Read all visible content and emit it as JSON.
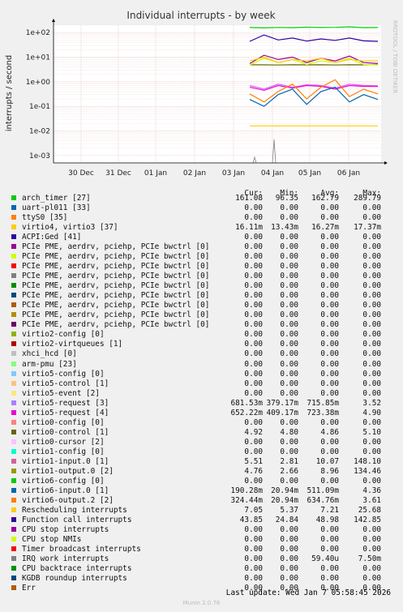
{
  "chart_data": {
    "type": "line",
    "title": "Individual interrupts - by week",
    "ylabel": "interrupts / second",
    "yscale": "log",
    "ylim": [
      0.0005,
      200
    ],
    "y_ticks": [
      "1e+02",
      "1e+01",
      "1e+00",
      "1e-01",
      "1e-02",
      "1e-03"
    ],
    "x_ticks": [
      "30 Dec",
      "31 Dec",
      "01 Jan",
      "02 Jan",
      "03 Jan",
      "04 Jan",
      "05 Jan",
      "06 Jan"
    ],
    "data_start_label": "04 Jan",
    "series": [
      {
        "name": "arch_timer [27]",
        "color": "#00cc00",
        "values": [
          160,
          155,
          162,
          158,
          165,
          160,
          163,
          170,
          158,
          161
        ]
      },
      {
        "name": "uart-pl011 [33]",
        "color": "#0066b3",
        "values": []
      },
      {
        "name": "ttyS0 [35]",
        "color": "#ff8000",
        "values": []
      },
      {
        "name": "virtio4, virtio3 [37]",
        "color": "#ffcc00",
        "values": [
          0.016,
          0.016,
          0.016,
          0.016,
          0.016,
          0.016,
          0.016,
          0.016,
          0.016,
          0.016
        ]
      },
      {
        "name": "virtio5-request [3]",
        "color": "#cc66ff",
        "values": [
          0.7,
          0.5,
          0.8,
          0.6,
          0.75,
          0.7,
          0.55,
          0.8,
          0.7,
          0.68
        ]
      },
      {
        "name": "virtio5-request [4]",
        "color": "#ff00cc",
        "values": [
          0.6,
          0.45,
          0.7,
          0.55,
          0.7,
          0.65,
          0.5,
          0.7,
          0.65,
          0.65
        ]
      },
      {
        "name": "virtio0-control [1]",
        "color": "#666600",
        "values": [
          4.9,
          4.85,
          4.8,
          4.9,
          4.85,
          4.9,
          4.8,
          4.9,
          4.85,
          4.92
        ]
      },
      {
        "name": "virtio1-input.0 [1]",
        "color": "#990099",
        "values": [
          5.5,
          12,
          8,
          10,
          6,
          9,
          7,
          11,
          6,
          5.5
        ]
      },
      {
        "name": "virtio1-output.0 [2]",
        "color": "#ccff00",
        "values": [
          4.8,
          9,
          6,
          8,
          5,
          7,
          6,
          9,
          5,
          4.8
        ]
      },
      {
        "name": "virtio6-input.0 [1]",
        "color": "#0066b3",
        "values": [
          0.19,
          0.1,
          0.3,
          0.5,
          0.12,
          0.4,
          0.6,
          0.15,
          0.3,
          0.19
        ]
      },
      {
        "name": "virtio6-output.2 [2]",
        "color": "#ff8000",
        "values": [
          0.32,
          0.15,
          0.4,
          0.8,
          0.2,
          0.6,
          1.2,
          0.25,
          0.5,
          0.32
        ]
      },
      {
        "name": "Rescheduling interrupts",
        "color": "#ffcc00",
        "values": [
          7,
          10,
          6,
          8,
          7,
          9,
          6,
          8,
          7,
          7.05
        ]
      },
      {
        "name": "Function call interrupts",
        "color": "#330099",
        "values": [
          44,
          80,
          50,
          60,
          45,
          55,
          48,
          60,
          46,
          43.85
        ]
      }
    ]
  },
  "legend": {
    "headers": {
      "cur": "Cur:",
      "min": "Min:",
      "avg": "Avg:",
      "max": "Max:"
    },
    "rows": [
      {
        "color": "#00cc00",
        "name": "arch_timer [27]",
        "cur": "161.08",
        "min": "96.35",
        "avg": "162.79",
        "max": "289.79"
      },
      {
        "color": "#0066b3",
        "name": "uart-pl011 [33]",
        "cur": "0.00",
        "min": "0.00",
        "avg": "0.00",
        "max": "0.00"
      },
      {
        "color": "#ff8000",
        "name": "ttyS0 [35]",
        "cur": "0.00",
        "min": "0.00",
        "avg": "0.00",
        "max": "0.00"
      },
      {
        "color": "#ffcc00",
        "name": "virtio4, virtio3 [37]",
        "cur": "16.11m",
        "min": "13.43m",
        "avg": "16.27m",
        "max": "17.37m"
      },
      {
        "color": "#330099",
        "name": "ACPI:Ged [41]",
        "cur": "0.00",
        "min": "0.00",
        "avg": "0.00",
        "max": "0.00"
      },
      {
        "color": "#990099",
        "name": "PCIe PME, aerdrv, pciehp, PCIe bwctrl [0]",
        "cur": "0.00",
        "min": "0.00",
        "avg": "0.00",
        "max": "0.00"
      },
      {
        "color": "#ccff00",
        "name": "PCIe PME, aerdrv, pciehp, PCIe bwctrl [0]",
        "cur": "0.00",
        "min": "0.00",
        "avg": "0.00",
        "max": "0.00"
      },
      {
        "color": "#ff0000",
        "name": "PCIe PME, aerdrv, pciehp, PCIe bwctrl [0]",
        "cur": "0.00",
        "min": "0.00",
        "avg": "0.00",
        "max": "0.00"
      },
      {
        "color": "#808080",
        "name": "PCIe PME, aerdrv, pciehp, PCIe bwctrl [0]",
        "cur": "0.00",
        "min": "0.00",
        "avg": "0.00",
        "max": "0.00"
      },
      {
        "color": "#008f00",
        "name": "PCIe PME, aerdrv, pciehp, PCIe bwctrl [0]",
        "cur": "0.00",
        "min": "0.00",
        "avg": "0.00",
        "max": "0.00"
      },
      {
        "color": "#00487d",
        "name": "PCIe PME, aerdrv, pciehp, PCIe bwctrl [0]",
        "cur": "0.00",
        "min": "0.00",
        "avg": "0.00",
        "max": "0.00"
      },
      {
        "color": "#b35a00",
        "name": "PCIe PME, aerdrv, pciehp, PCIe bwctrl [0]",
        "cur": "0.00",
        "min": "0.00",
        "avg": "0.00",
        "max": "0.00"
      },
      {
        "color": "#b38f00",
        "name": "PCIe PME, aerdrv, pciehp, PCIe bwctrl [0]",
        "cur": "0.00",
        "min": "0.00",
        "avg": "0.00",
        "max": "0.00"
      },
      {
        "color": "#6b006b",
        "name": "PCIe PME, aerdrv, pciehp, PCIe bwctrl [0]",
        "cur": "0.00",
        "min": "0.00",
        "avg": "0.00",
        "max": "0.00"
      },
      {
        "color": "#8fb300",
        "name": "virtio2-config [0]",
        "cur": "0.00",
        "min": "0.00",
        "avg": "0.00",
        "max": "0.00"
      },
      {
        "color": "#b30000",
        "name": "virtio2-virtqueues [1]",
        "cur": "0.00",
        "min": "0.00",
        "avg": "0.00",
        "max": "0.00"
      },
      {
        "color": "#bebebe",
        "name": "xhci_hcd [0]",
        "cur": "0.00",
        "min": "0.00",
        "avg": "0.00",
        "max": "0.00"
      },
      {
        "color": "#80ff80",
        "name": "arm-pmu [23]",
        "cur": "0.00",
        "min": "0.00",
        "avg": "0.00",
        "max": "0.00"
      },
      {
        "color": "#80c9ff",
        "name": "virtio5-config [0]",
        "cur": "0.00",
        "min": "0.00",
        "avg": "0.00",
        "max": "0.00"
      },
      {
        "color": "#ffc080",
        "name": "virtio5-control [1]",
        "cur": "0.00",
        "min": "0.00",
        "avg": "0.00",
        "max": "0.00"
      },
      {
        "color": "#ffe680",
        "name": "virtio5-event [2]",
        "cur": "0.00",
        "min": "0.00",
        "avg": "0.00",
        "max": "0.00"
      },
      {
        "color": "#aa80ff",
        "name": "virtio5-request [3]",
        "cur": "681.53m",
        "min": "379.17m",
        "avg": "715.85m",
        "max": "3.52"
      },
      {
        "color": "#ee00cc",
        "name": "virtio5-request [4]",
        "cur": "652.22m",
        "min": "409.17m",
        "avg": "723.38m",
        "max": "4.90"
      },
      {
        "color": "#ff8080",
        "name": "virtio0-config [0]",
        "cur": "0.00",
        "min": "0.00",
        "avg": "0.00",
        "max": "0.00"
      },
      {
        "color": "#666600",
        "name": "virtio0-control [1]",
        "cur": "4.92",
        "min": "4.80",
        "avg": "4.86",
        "max": "5.10"
      },
      {
        "color": "#ffbfff",
        "name": "virtio0-cursor [2]",
        "cur": "0.00",
        "min": "0.00",
        "avg": "0.00",
        "max": "0.00"
      },
      {
        "color": "#00ffcc",
        "name": "virtio1-config [0]",
        "cur": "0.00",
        "min": "0.00",
        "avg": "0.00",
        "max": "0.00"
      },
      {
        "color": "#cc6699",
        "name": "virtio1-input.0 [1]",
        "cur": "5.51",
        "min": "2.81",
        "avg": "10.07",
        "max": "148.10"
      },
      {
        "color": "#999900",
        "name": "virtio1-output.0 [2]",
        "cur": "4.76",
        "min": "2.66",
        "avg": "8.96",
        "max": "134.46"
      },
      {
        "color": "#00cc00",
        "name": "virtio6-config [0]",
        "cur": "0.00",
        "min": "0.00",
        "avg": "0.00",
        "max": "0.00"
      },
      {
        "color": "#0066b3",
        "name": "virtio6-input.0 [1]",
        "cur": "190.28m",
        "min": "20.94m",
        "avg": "511.09m",
        "max": "4.36"
      },
      {
        "color": "#ff8000",
        "name": "virtio6-output.2 [2]",
        "cur": "324.44m",
        "min": "20.94m",
        "avg": "634.76m",
        "max": "3.61"
      },
      {
        "color": "#ffcc00",
        "name": "Rescheduling interrupts",
        "cur": "7.05",
        "min": "5.37",
        "avg": "7.21",
        "max": "25.68"
      },
      {
        "color": "#330099",
        "name": "Function call interrupts",
        "cur": "43.85",
        "min": "24.84",
        "avg": "48.98",
        "max": "142.85"
      },
      {
        "color": "#990099",
        "name": "CPU stop interrupts",
        "cur": "0.00",
        "min": "0.00",
        "avg": "0.00",
        "max": "0.00"
      },
      {
        "color": "#ccff00",
        "name": "CPU stop NMIs",
        "cur": "0.00",
        "min": "0.00",
        "avg": "0.00",
        "max": "0.00"
      },
      {
        "color": "#ff0000",
        "name": "Timer broadcast interrupts",
        "cur": "0.00",
        "min": "0.00",
        "avg": "0.00",
        "max": "0.00"
      },
      {
        "color": "#808080",
        "name": "IRQ work interrupts",
        "cur": "0.00",
        "min": "0.00",
        "avg": "59.40u",
        "max": "7.50m"
      },
      {
        "color": "#008f00",
        "name": "CPU backtrace interrupts",
        "cur": "0.00",
        "min": "0.00",
        "avg": "0.00",
        "max": "0.00"
      },
      {
        "color": "#00487d",
        "name": "KGDB roundup interrupts",
        "cur": "0.00",
        "min": "0.00",
        "avg": "0.00",
        "max": "0.00"
      },
      {
        "color": "#b35a00",
        "name": "Err",
        "cur": "0.00",
        "min": "0.00",
        "avg": "0.00",
        "max": "0.00"
      }
    ]
  },
  "footer": {
    "last_update": "Last update: Wed Jan  7 05:58:45 2026",
    "version": "Munin 2.0.76"
  },
  "side_label": "RRDTOOL / TOBI OETIKER"
}
